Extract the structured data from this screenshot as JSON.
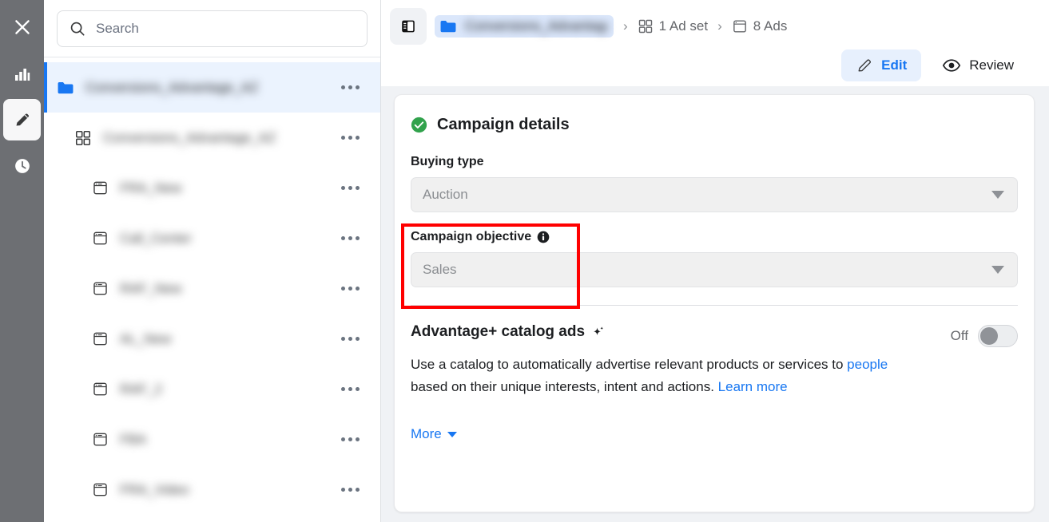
{
  "rail": {
    "items": [
      {
        "icon": "close-icon",
        "name": "close-button",
        "active": false
      },
      {
        "icon": "bar-chart-icon",
        "name": "analytics-button",
        "active": false
      },
      {
        "icon": "pencil-icon",
        "name": "edit-button",
        "active": true
      },
      {
        "icon": "clock-icon",
        "name": "history-button",
        "active": false
      }
    ]
  },
  "sidebar": {
    "search": {
      "placeholder": "Search",
      "value": "",
      "icon": "search-icon"
    },
    "tree": [
      {
        "level": "campaign",
        "icon": "folder-icon",
        "label": "Conversions_Advantage_AZ",
        "redacted": true,
        "selected": true
      },
      {
        "level": "adset",
        "icon": "grid-icon",
        "label": "Conversions_Advantage_AZ",
        "redacted": true,
        "selected": false
      },
      {
        "level": "ad",
        "icon": "ad-icon",
        "label": "FRA_New",
        "redacted": true,
        "selected": false
      },
      {
        "level": "ad",
        "icon": "ad-icon",
        "label": "Call_Center",
        "redacted": true,
        "selected": false
      },
      {
        "level": "ad",
        "icon": "ad-icon",
        "label": "RAF_New",
        "redacted": true,
        "selected": false
      },
      {
        "level": "ad",
        "icon": "ad-icon",
        "label": "AL_New",
        "redacted": true,
        "selected": false
      },
      {
        "level": "ad",
        "icon": "ad-icon",
        "label": "RAF_2",
        "redacted": true,
        "selected": false
      },
      {
        "level": "ad",
        "icon": "ad-icon",
        "label": "FBA",
        "redacted": true,
        "selected": false
      },
      {
        "level": "ad",
        "icon": "ad-icon",
        "label": "FRA_Video",
        "redacted": true,
        "selected": false
      }
    ],
    "row_menu_icon": "ellipsis-icon"
  },
  "topbar": {
    "panel_toggle_icon": "sidebar-panel-icon",
    "breadcrumb": {
      "campaign": {
        "icon": "folder-icon",
        "label": "Conversions_Advantage_AZ",
        "redacted": true
      },
      "separator": "›",
      "adset": {
        "icon": "grid-icon",
        "label": "1 Ad set"
      },
      "ads": {
        "icon": "ad-icon",
        "label": "8 Ads"
      }
    },
    "actions": {
      "edit": {
        "label": "Edit",
        "icon": "pencil-icon",
        "active": true
      },
      "review": {
        "label": "Review",
        "icon": "eye-icon",
        "active": false
      }
    }
  },
  "card": {
    "title": "Campaign details",
    "title_status_icon": "green-check-icon",
    "buying_type": {
      "label": "Buying type",
      "value": "Auction",
      "disabled": true,
      "caret_icon": "chevron-down-icon"
    },
    "campaign_objective": {
      "label": "Campaign objective",
      "info_icon": "info-icon",
      "value": "Sales",
      "disabled": true,
      "caret_icon": "chevron-down-icon",
      "highlighted": true,
      "highlight_color": "#ff0000"
    },
    "advantage": {
      "title": "Advantage+ catalog ads",
      "sparkle_icon": "sparkle-icon",
      "toggle_label": "Off",
      "toggle_on": false,
      "description_part1": "Use a catalog to automatically advertise relevant products or services to ",
      "description_link1": "people",
      "description_part2": " based on their unique interests, intent and actions. ",
      "description_link2": "Learn more"
    },
    "more": {
      "label": "More",
      "caret_icon": "caret-down-icon"
    }
  },
  "colors": {
    "accent_blue": "#1877f2",
    "status_green": "#31a24c",
    "highlight_red": "#ff0000",
    "rail_bg": "#6d6f73",
    "main_bg": "#f0f2f5"
  }
}
